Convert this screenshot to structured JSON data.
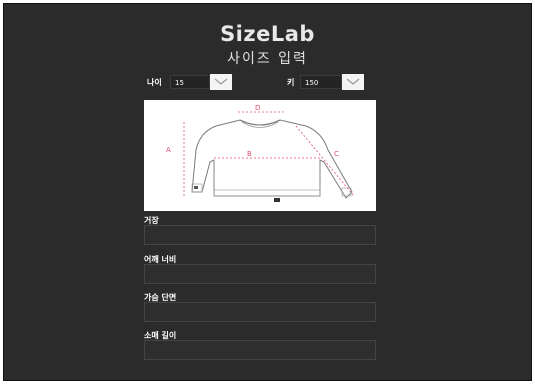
{
  "app": {
    "title": "SizeLab",
    "subtitle": "사이즈 입력"
  },
  "age": {
    "label": "나이",
    "value": "15"
  },
  "height": {
    "label": "키",
    "value": "150"
  },
  "diagram": {
    "labels": {
      "a": "A",
      "b": "B",
      "c": "C",
      "d": "D"
    }
  },
  "fields": [
    {
      "label": "거장",
      "value": ""
    },
    {
      "label": "어깨 너비",
      "value": ""
    },
    {
      "label": "가슴 단면",
      "value": ""
    },
    {
      "label": "소매 길이",
      "value": ""
    }
  ],
  "colors": {
    "background": "#2b2b2b",
    "measure": "#e05070"
  },
  "icons": {
    "dropdown": "chevron-down-icon"
  }
}
